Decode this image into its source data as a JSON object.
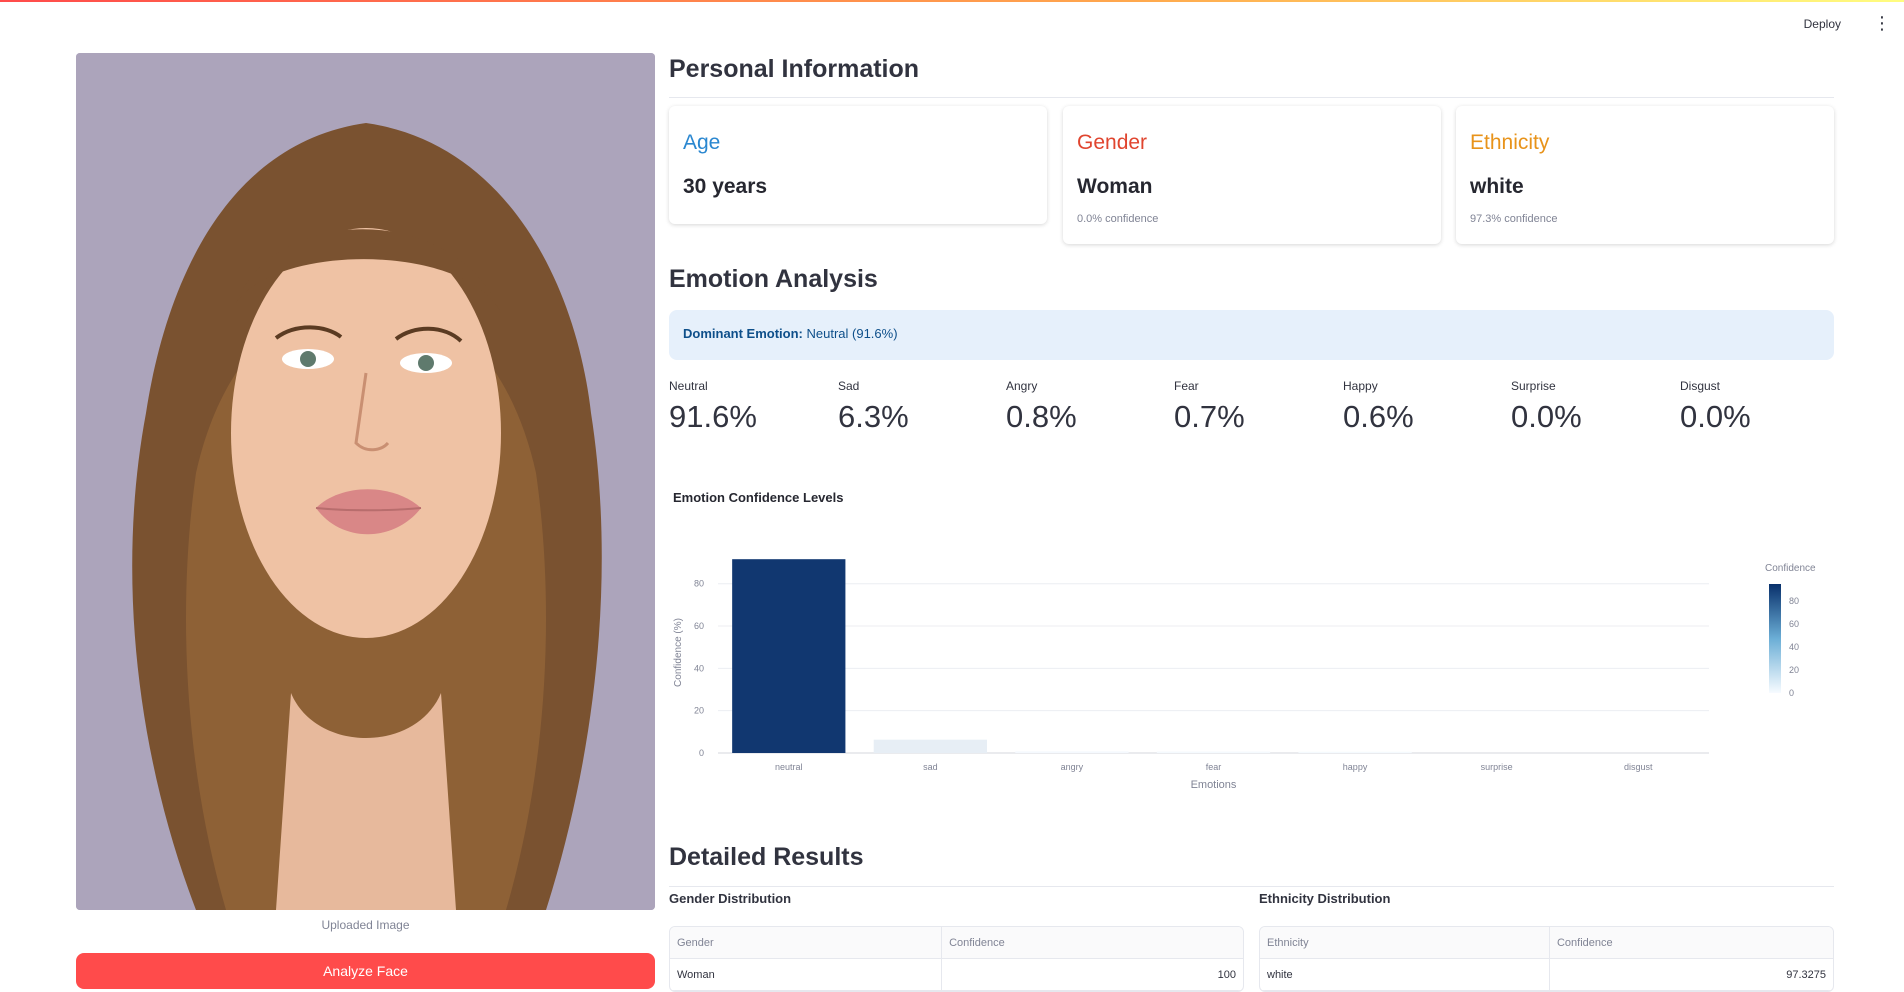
{
  "header": {
    "deploy_label": "Deploy",
    "menu_icon": "more-vertical-icon"
  },
  "left": {
    "image_caption": "Uploaded Image",
    "analyze_button": "Analyze Face"
  },
  "personal": {
    "title": "Personal Information",
    "cards": [
      {
        "label": "Age",
        "value": "30 years",
        "sub": "",
        "color": "#2a87d0"
      },
      {
        "label": "Gender",
        "value": "Woman",
        "sub": "0.0% confidence",
        "color": "#e0452f"
      },
      {
        "label": "Ethnicity",
        "value": "white",
        "sub": "97.3% confidence",
        "color": "#e8931a"
      }
    ]
  },
  "emotion": {
    "title": "Emotion Analysis",
    "dominant_label": "Dominant Emotion:",
    "dominant_value": " Neutral (91.6%)",
    "metrics": [
      {
        "label": "Neutral",
        "value": "91.6%"
      },
      {
        "label": "Sad",
        "value": "6.3%"
      },
      {
        "label": "Angry",
        "value": "0.8%"
      },
      {
        "label": "Fear",
        "value": "0.7%"
      },
      {
        "label": "Happy",
        "value": "0.6%"
      },
      {
        "label": "Surprise",
        "value": "0.0%"
      },
      {
        "label": "Disgust",
        "value": "0.0%"
      }
    ],
    "chart_title": "Emotion Confidence Levels"
  },
  "chart_data": {
    "type": "bar",
    "title": "Emotion Confidence Levels",
    "categories": [
      "neutral",
      "sad",
      "angry",
      "fear",
      "happy",
      "surprise",
      "disgust"
    ],
    "values": [
      91.6,
      6.3,
      0.8,
      0.7,
      0.6,
      0.0,
      0.0
    ],
    "xlabel": "Emotions",
    "ylabel": "Confidence (%)",
    "ylim": [
      0,
      95
    ],
    "yticks": [
      0,
      20,
      40,
      60,
      80
    ],
    "grid": true,
    "colorbar": {
      "title": "Confidence",
      "ticks": [
        0,
        20,
        40,
        60,
        80
      ],
      "low_color": "#f7fbff",
      "high_color": "#08306b"
    }
  },
  "detailed": {
    "title": "Detailed Results",
    "gender": {
      "title": "Gender Distribution",
      "headers": [
        "Gender",
        "Confidence"
      ],
      "rows": [
        [
          "Woman",
          "100"
        ]
      ]
    },
    "ethnicity": {
      "title": "Ethnicity Distribution",
      "headers": [
        "Ethnicity",
        "Confidence"
      ],
      "rows": [
        [
          "white",
          "97.3275"
        ]
      ]
    }
  }
}
